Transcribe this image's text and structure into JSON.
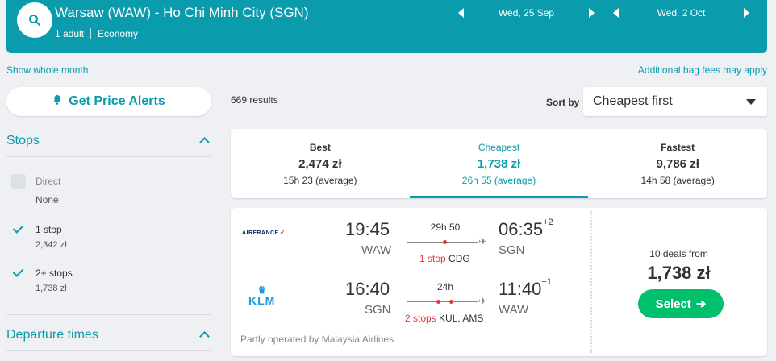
{
  "header": {
    "route": "Warsaw (WAW) - Ho Chi Minh City (SGN)",
    "passengers": "1 adult",
    "cabin": "Economy",
    "depart_date": "Wed, 25 Sep",
    "return_date": "Wed, 2 Oct"
  },
  "links": {
    "show_whole_month": "Show whole month",
    "bag_fees": "Additional bag fees may apply"
  },
  "sidebar": {
    "price_alerts": "Get Price Alerts",
    "stops_title": "Stops",
    "stops": [
      {
        "label": "Direct",
        "price": "None",
        "state": "disabled"
      },
      {
        "label": "1 stop",
        "price": "2,342 zł",
        "state": "checked"
      },
      {
        "label": "2+ stops",
        "price": "1,738 zł",
        "state": "checked"
      }
    ],
    "departure_title": "Departure times"
  },
  "results": {
    "count": "669 results",
    "sort_label": "Sort by",
    "sort_value": "Cheapest first"
  },
  "tabs": [
    {
      "label": "Best",
      "price": "2,474 zł",
      "duration": "15h 23 (average)"
    },
    {
      "label": "Cheapest",
      "price": "1,738 zł",
      "duration": "26h 55 (average)"
    },
    {
      "label": "Fastest",
      "price": "9,786 zł",
      "duration": "14h 58 (average)"
    }
  ],
  "card": {
    "outbound": {
      "airline": "AIRFRANCE",
      "dep_time": "19:45",
      "dep_code": "WAW",
      "arr_time": "06:35",
      "arr_offset": "+2",
      "arr_code": "SGN",
      "duration": "29h 50",
      "stops": "1 stop",
      "via": "CDG"
    },
    "inbound": {
      "airline": "KLM",
      "dep_time": "16:40",
      "dep_code": "SGN",
      "arr_time": "11:40",
      "arr_offset": "+1",
      "arr_code": "WAW",
      "duration": "24h",
      "stops": "2 stops",
      "via": "KUL, AMS"
    },
    "operated": "Partly operated by Malaysia Airlines",
    "deals": "10 deals from",
    "price": "1,738 zł",
    "select": "Select"
  },
  "colors": {
    "brand": "#0a9bac",
    "select": "#00c06b",
    "stop_red": "#e0383e"
  }
}
